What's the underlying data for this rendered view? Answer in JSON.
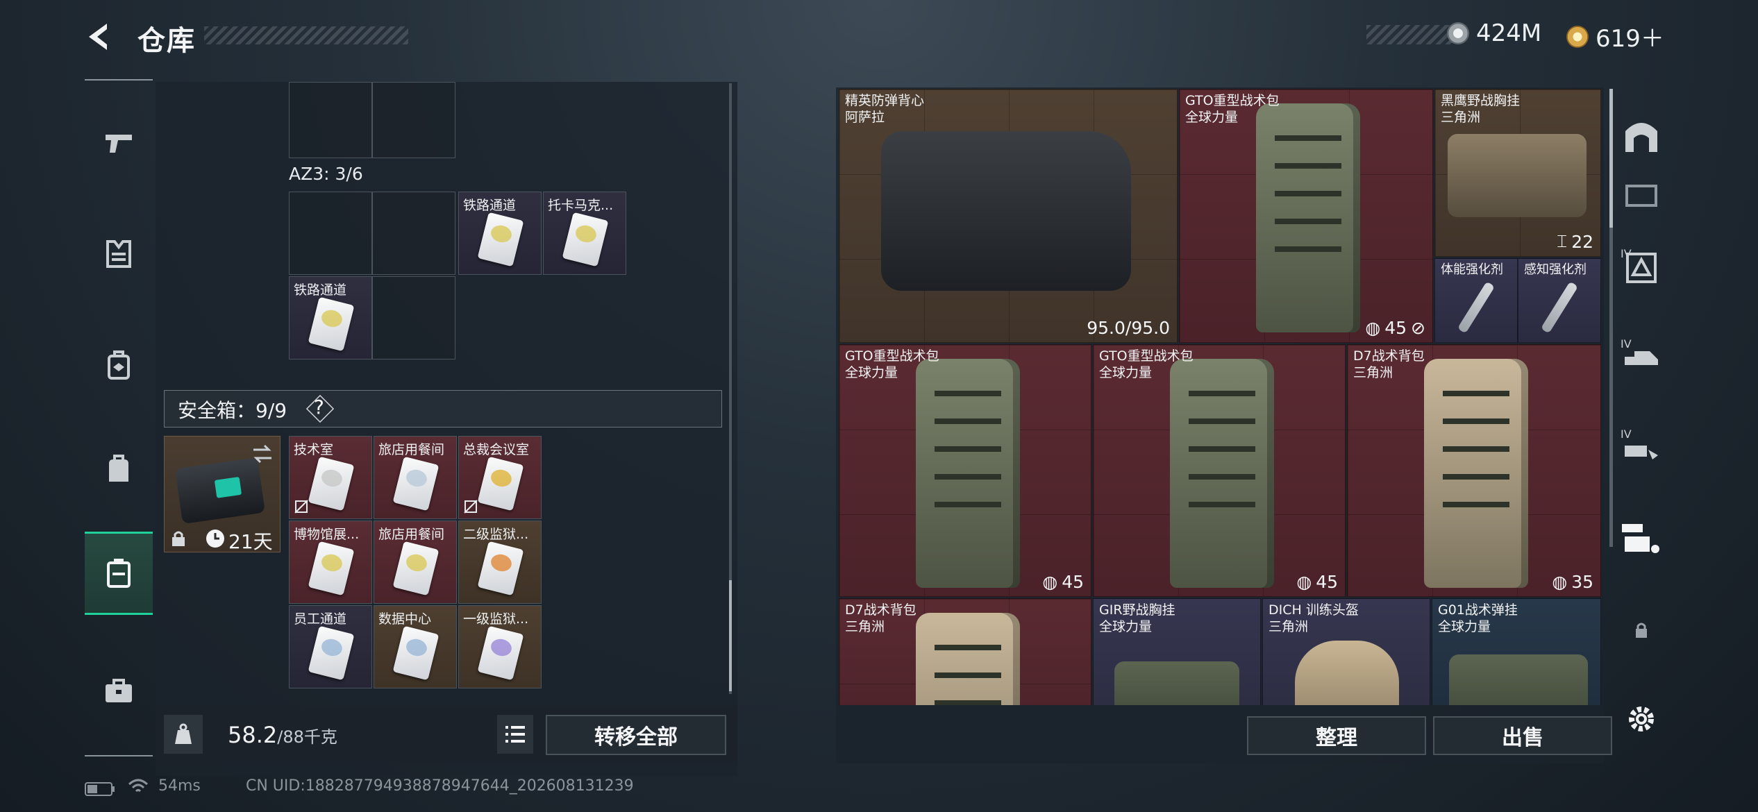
{
  "header": {
    "title": "仓库",
    "currency_silver": "424M",
    "currency_gold": "619＋"
  },
  "left_nav": {
    "items": [
      "pistol-icon",
      "armor-icon",
      "backpack-rig-icon",
      "backpack-icon",
      "safe-box-icon",
      "briefcase-icon"
    ],
    "active_index": 4
  },
  "storage": {
    "az3_label": "AZ3: 3/6",
    "cells": [
      {
        "label": "铁路通道",
        "color": "#d9c95a"
      },
      {
        "label": "托卡马克...",
        "color": "#d9c95a"
      },
      {
        "label": "铁路通道",
        "color": "#d9c95a"
      }
    ]
  },
  "safe_box": {
    "title": "安全箱：9/9",
    "help": "?",
    "duration": "21天",
    "keys": [
      {
        "label": "技术室",
        "tint": "red",
        "color": "#c8c8c8",
        "noslot": true
      },
      {
        "label": "旅店用餐间",
        "tint": "red",
        "color": "#b9c9d9",
        "noslot": false
      },
      {
        "label": "总裁会议室",
        "tint": "red",
        "color": "#e0b43a",
        "noslot": true
      },
      {
        "label": "博物馆展...",
        "tint": "red",
        "color": "#d9c95a",
        "noslot": false
      },
      {
        "label": "旅店用餐间",
        "tint": "red",
        "color": "#d9c95a",
        "noslot": false
      },
      {
        "label": "二级监狱...",
        "tint": "brown",
        "color": "#e08a3a",
        "noslot": false
      },
      {
        "label": "员工通道",
        "tint": "item",
        "color": "#9bb8d8",
        "noslot": false
      },
      {
        "label": "数据中心",
        "tint": "brown",
        "color": "#9bb8d8",
        "noslot": false
      },
      {
        "label": "一级监狱...",
        "tint": "brown",
        "color": "#9b8ad8",
        "noslot": false
      }
    ]
  },
  "bottom_bar": {
    "weight": "58.2",
    "weight_max": "/88千克",
    "transfer_all": "转移全部"
  },
  "inventory": {
    "items": [
      {
        "name": "精英防弹背心",
        "sub": "阿萨拉",
        "value": "95.0/95.0"
      },
      {
        "name": "GTO重型战术包",
        "sub": "全球力量",
        "value": "45"
      },
      {
        "name": "黑鹰野战胸挂",
        "sub": "三角洲",
        "value": "22"
      },
      {
        "name": "体能强化剂",
        "sub": ""
      },
      {
        "name": "感知强化剂",
        "sub": ""
      },
      {
        "name": "GTO重型战术包",
        "sub": "全球力量",
        "value": "45"
      },
      {
        "name": "GTO重型战术包",
        "sub": "全球力量",
        "value": "45"
      },
      {
        "name": "D7战术背包",
        "sub": "三角洲",
        "value": "35"
      },
      {
        "name": "D7战术背包",
        "sub": "三角洲"
      },
      {
        "name": "GIR野战胸挂",
        "sub": "全球力量"
      },
      {
        "name": "DICH 训练头盔",
        "sub": "三角洲"
      },
      {
        "name": "G01战术弹挂",
        "sub": "全球力量"
      }
    ],
    "sort_label": "整理",
    "sell_label": "出售"
  },
  "right_nav": {
    "tier_labels": [
      "IV",
      "IV",
      "IV"
    ]
  },
  "footer": {
    "ping": "54ms",
    "uid": "CN UID:1882877949388789476​44_202608131239"
  }
}
